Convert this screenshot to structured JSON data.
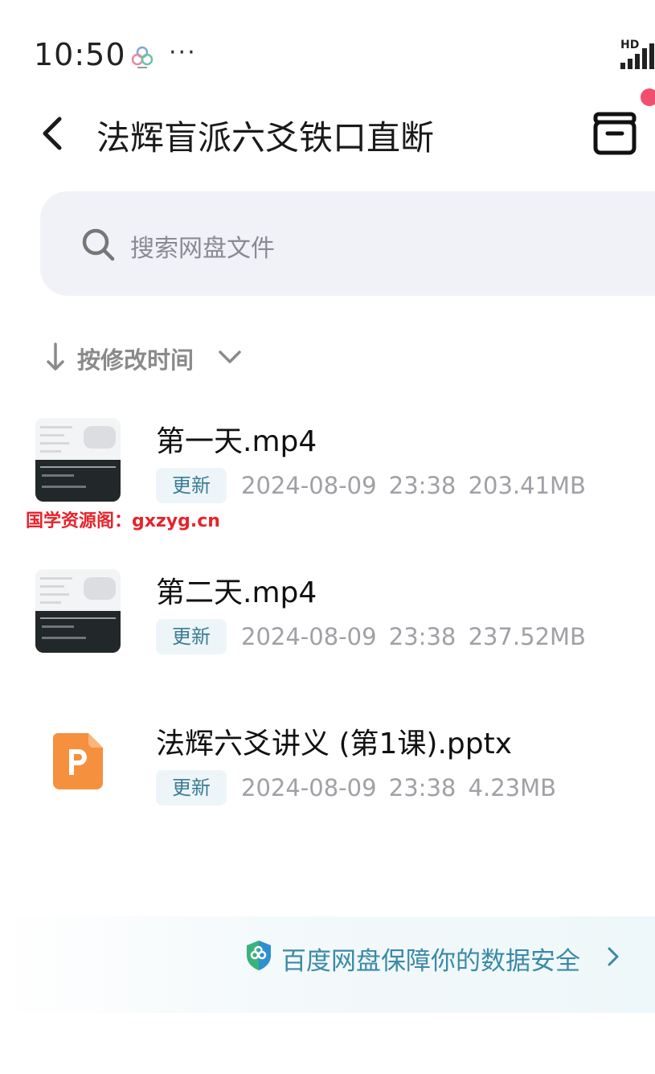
{
  "status_bar": {
    "time": "10:50",
    "more": "···",
    "network": "HD"
  },
  "header": {
    "title": "法辉盲派六爻铁口直断"
  },
  "search": {
    "placeholder": "搜索网盘文件"
  },
  "sort": {
    "label": "按修改时间"
  },
  "files": [
    {
      "name": "第一天.mp4",
      "badge": "更新",
      "date": "2024-08-09",
      "time": "23:38",
      "size": "203.41MB",
      "type": "video"
    },
    {
      "name": "第二天.mp4",
      "badge": "更新",
      "date": "2024-08-09",
      "time": "23:38",
      "size": "237.52MB",
      "type": "video"
    },
    {
      "name": "法辉六爻讲义 (第1课).pptx",
      "badge": "更新",
      "date": "2024-08-09",
      "time": "23:38",
      "size": "4.23MB",
      "type": "pptx"
    }
  ],
  "watermark": "国学资源阁：gxzyg.cn",
  "footer": {
    "safety_text": "百度网盘保障你的数据安全"
  },
  "colors": {
    "accent": "#3a8aa6",
    "badge_text": "#3a7d96",
    "badge_bg": "#eef5f8",
    "ppt_orange": "#f5903f",
    "notification": "#f0506e",
    "watermark": "#e8232a"
  }
}
